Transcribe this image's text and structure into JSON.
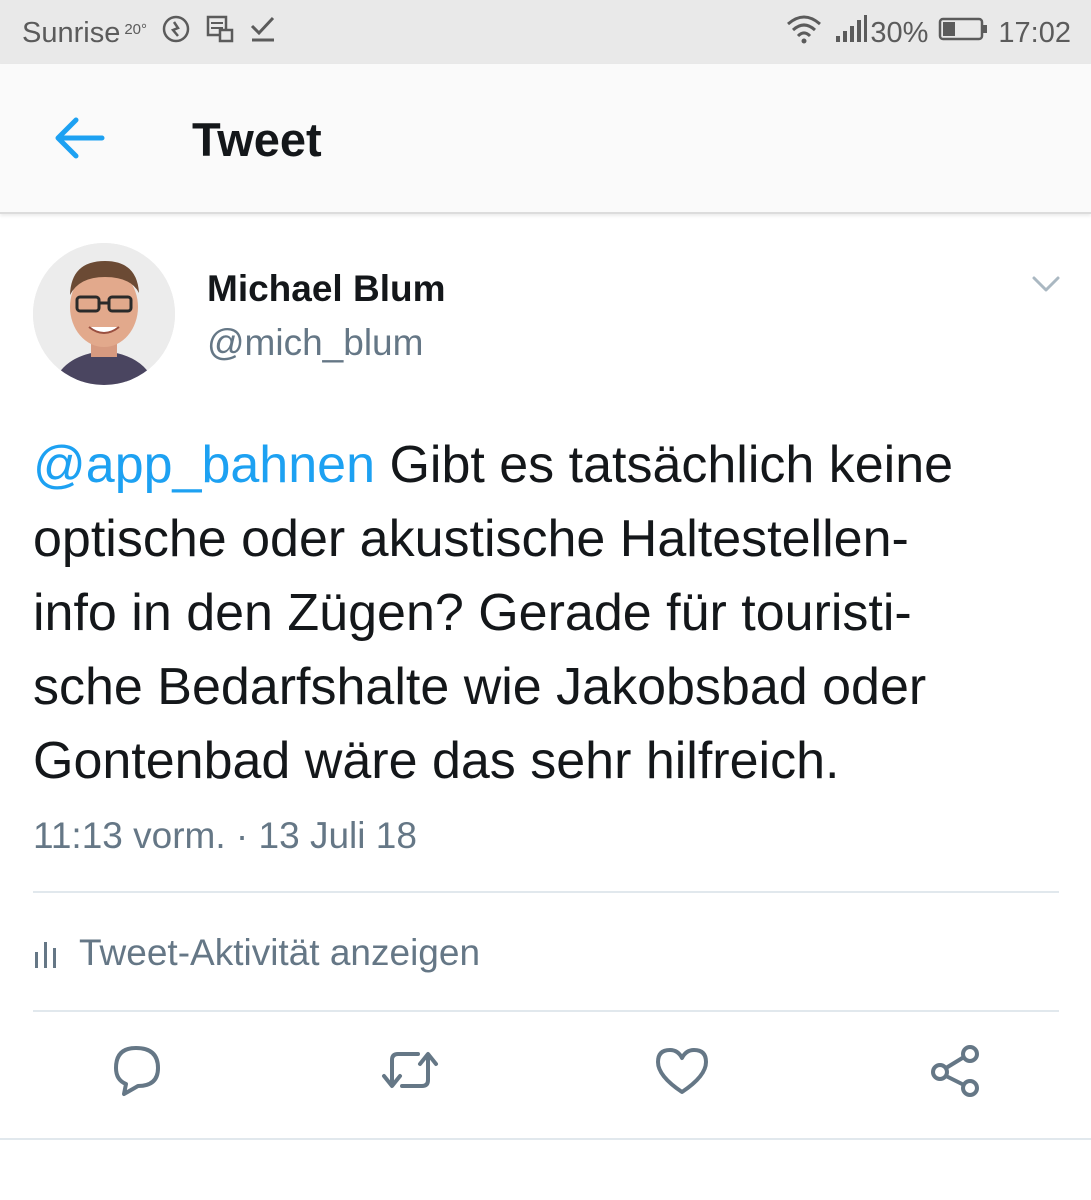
{
  "status_bar": {
    "carrier": "Sunrise",
    "temperature": "20°",
    "battery": "30%",
    "time": "17:02",
    "icons": [
      "nfc-icon",
      "sim-icon",
      "check-icon",
      "wifi-icon",
      "signal-icon",
      "battery-icon"
    ]
  },
  "app_bar": {
    "title": "Tweet",
    "back_icon": "arrow-left-icon"
  },
  "tweet": {
    "author_name": "Michael Blum",
    "author_handle": "@mich_blum",
    "mention": "@app_bahnen",
    "text_lines": [
      " Gibt es tatsächlich keine",
      "optische oder akustische Haltestellen-",
      "info in den Zügen? Gerade für touristi-",
      "sche Bedarfshalte wie Jakobsbad oder",
      "Gontenbad wäre das sehr hilfreich."
    ],
    "timestamp": "11:13 vorm. · 13 Juli 18"
  },
  "activity": {
    "label": "Tweet-Aktivität anzeigen",
    "icon": "bar-chart-icon"
  },
  "actions": [
    {
      "name": "reply",
      "icon": "reply-icon"
    },
    {
      "name": "retweet",
      "icon": "retweet-icon"
    },
    {
      "name": "like",
      "icon": "heart-icon"
    },
    {
      "name": "share",
      "icon": "share-icon"
    }
  ],
  "colors": {
    "accent": "#1da1f2",
    "secondary_text": "#657786",
    "primary_text": "#14171a",
    "status_bar_bg": "#e9e9e9"
  }
}
